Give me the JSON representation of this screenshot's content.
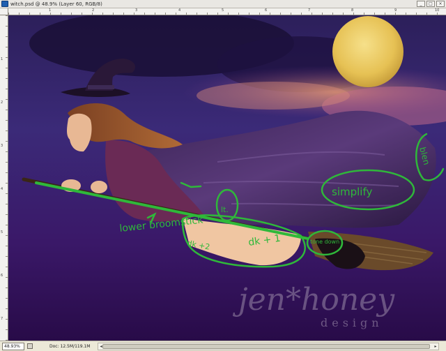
{
  "window": {
    "title": "witch.psd @ 48.9% (Layer 60, RGB/8)",
    "controls": [
      "minimize",
      "maximize",
      "close"
    ]
  },
  "rulers": {
    "top_numbers": [
      "1",
      "2",
      "3",
      "4",
      "5",
      "6",
      "7",
      "8",
      "9",
      "10"
    ],
    "left_numbers": [
      "1",
      "2",
      "3",
      "4",
      "5",
      "6",
      "7"
    ]
  },
  "annotations": {
    "lower_broomstick": "lower broomstick",
    "lt": "lt.",
    "dk_left": "dk +2",
    "dk_right": "dk + 1",
    "tone_down": "tone down",
    "simplify": "simplify",
    "blend": "blen"
  },
  "watermark": {
    "brand": "jen*honey",
    "sub": "design"
  },
  "status": {
    "zoom": "48.93%",
    "doc_size": "Doc: 12.5M/119.1M",
    "arrow": "▶"
  },
  "colors": {
    "annotation": "#2fb83a",
    "sky_top": "#3a1f68",
    "sky_bottom": "#2a0f4a",
    "moon": "#e9c75a"
  }
}
